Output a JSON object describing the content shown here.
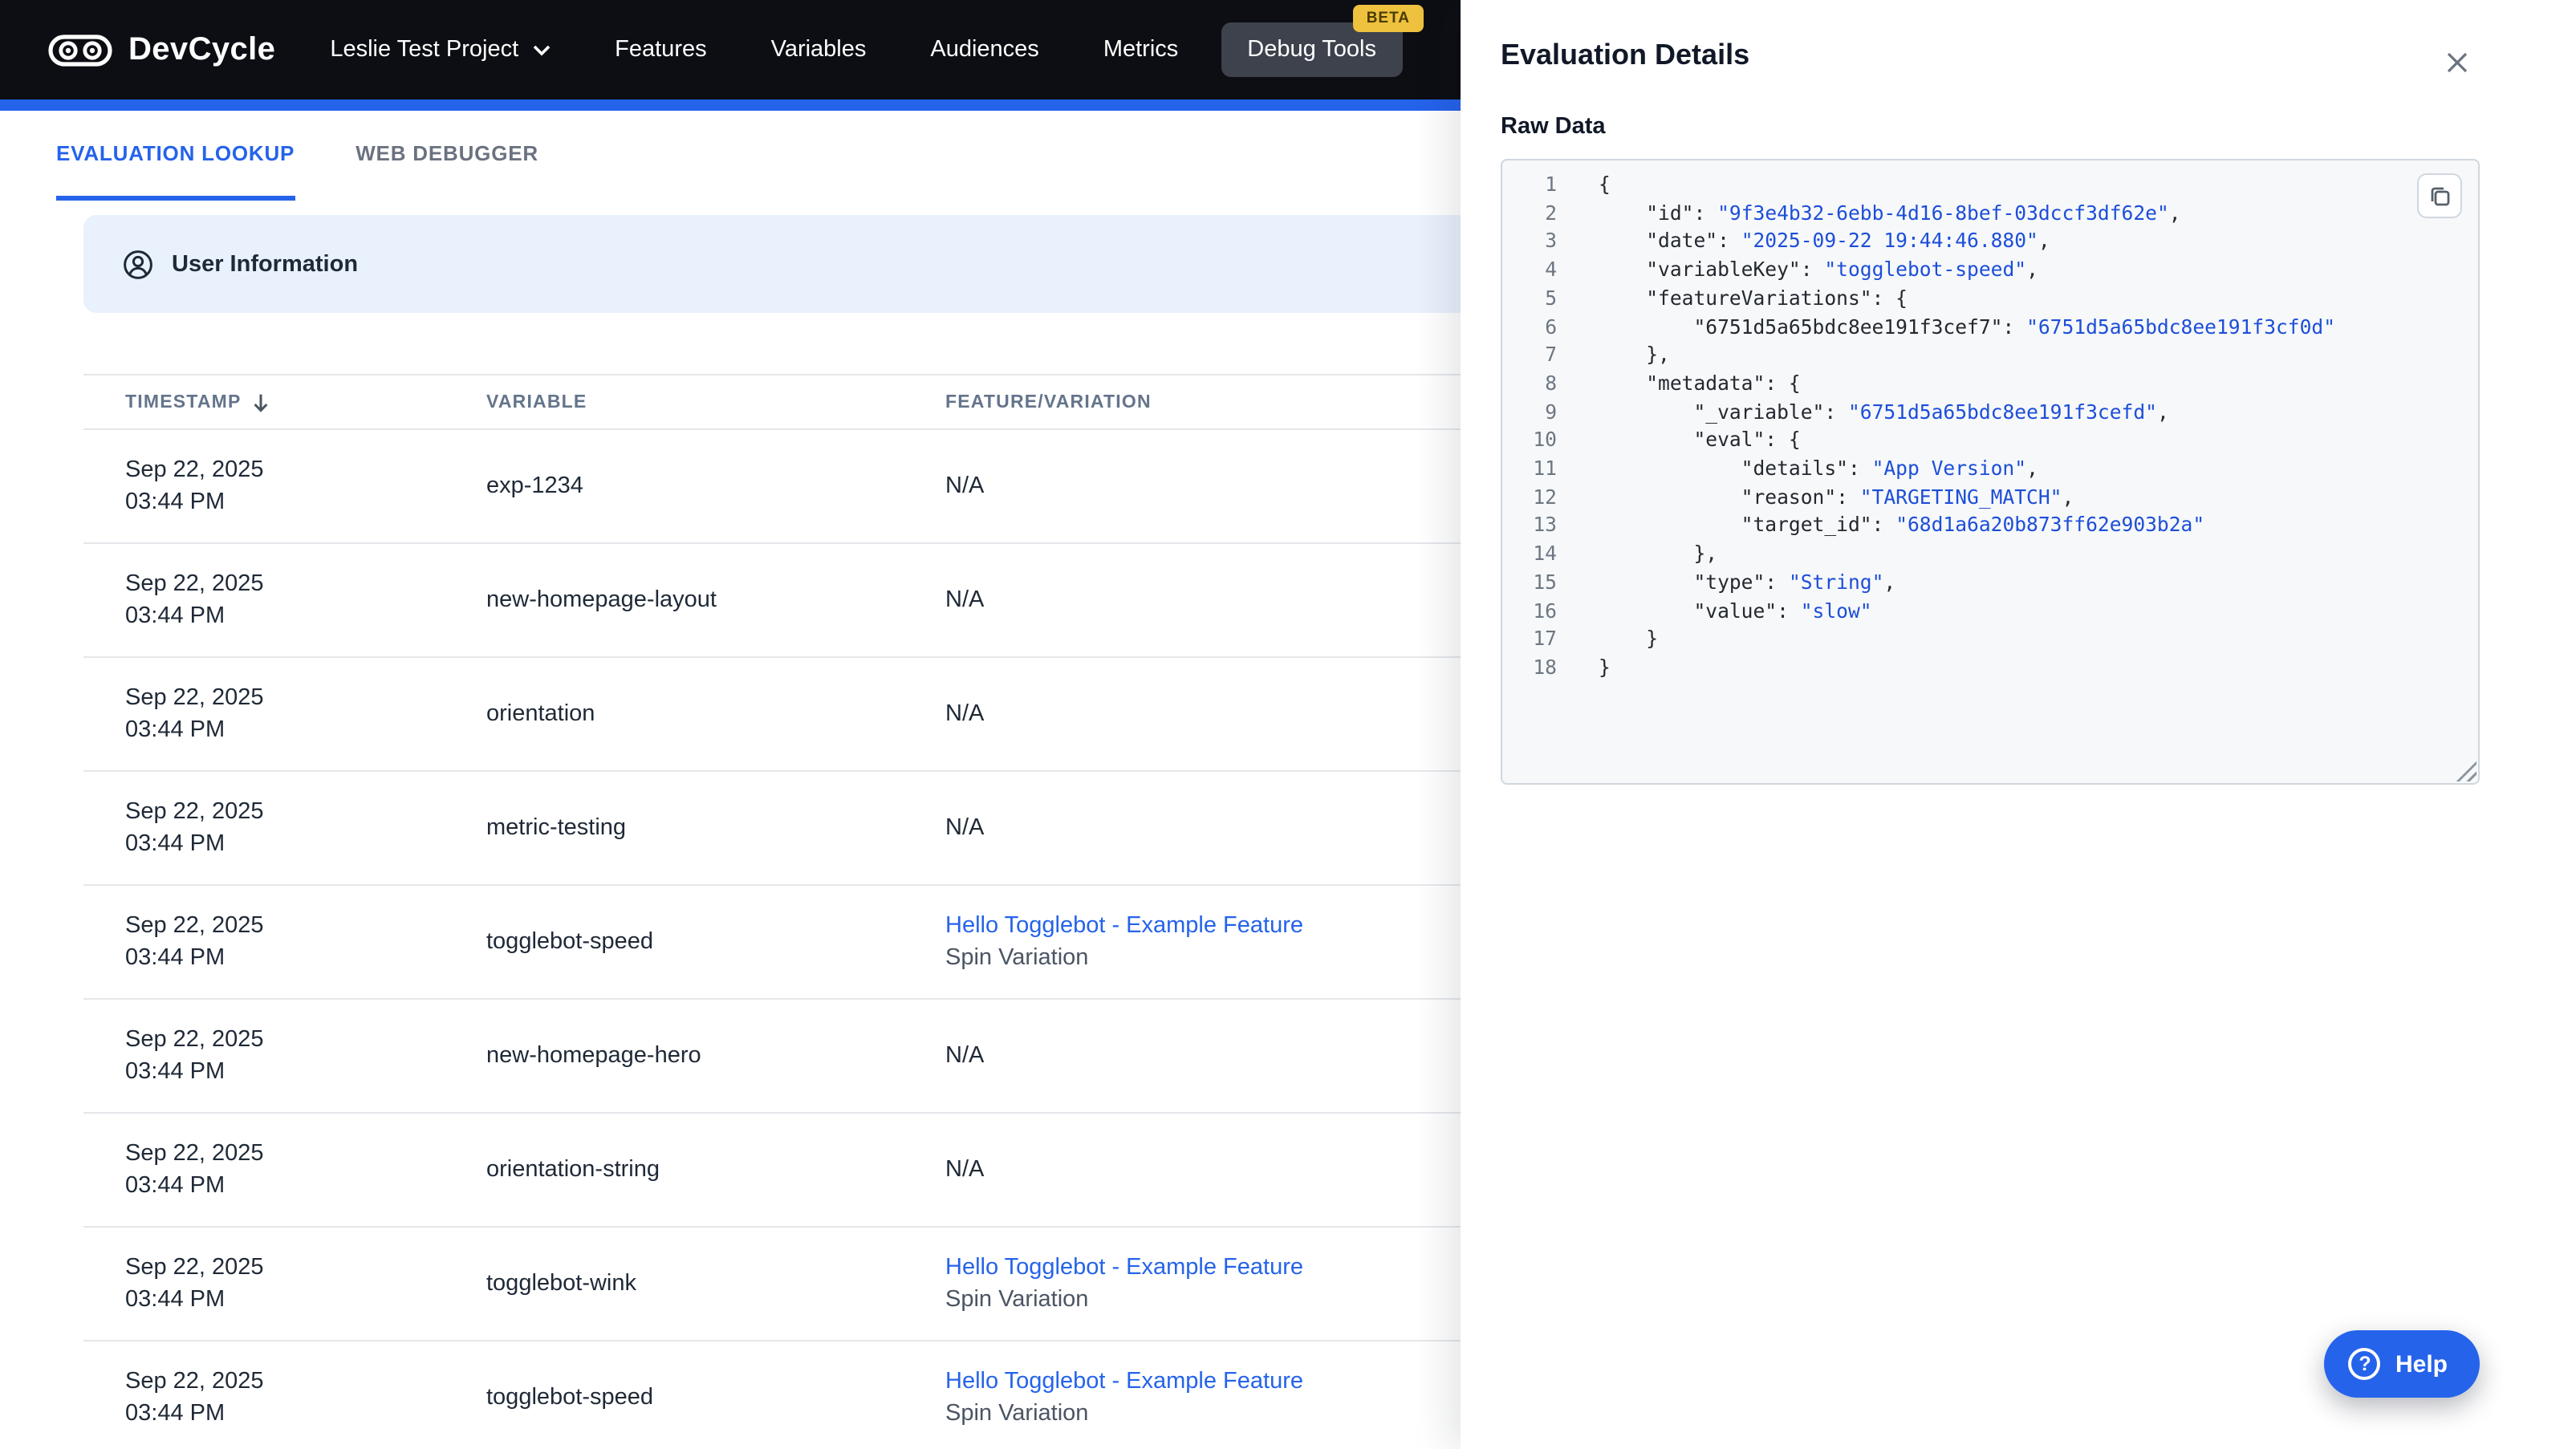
{
  "nav": {
    "brand": "DevCycle",
    "project": "Leslie Test Project",
    "items": [
      {
        "label": "Features"
      },
      {
        "label": "Variables"
      },
      {
        "label": "Audiences"
      },
      {
        "label": "Metrics"
      },
      {
        "label": "Debug Tools",
        "badge": "BETA"
      }
    ]
  },
  "tabs": [
    {
      "label": "EVALUATION LOOKUP"
    },
    {
      "label": "WEB DEBUGGER"
    }
  ],
  "banner": {
    "label": "User Information"
  },
  "table": {
    "columns": [
      "TIMESTAMP",
      "VARIABLE",
      "FEATURE/VARIATION"
    ],
    "rows": [
      {
        "date": "Sep 22, 2025",
        "time": "03:44 PM",
        "variable": "exp-1234",
        "feature": "N/A"
      },
      {
        "date": "Sep 22, 2025",
        "time": "03:44 PM",
        "variable": "new-homepage-layout",
        "feature": "N/A"
      },
      {
        "date": "Sep 22, 2025",
        "time": "03:44 PM",
        "variable": "orientation",
        "feature": "N/A"
      },
      {
        "date": "Sep 22, 2025",
        "time": "03:44 PM",
        "variable": "metric-testing",
        "feature": "N/A"
      },
      {
        "date": "Sep 22, 2025",
        "time": "03:44 PM",
        "variable": "togglebot-speed",
        "feature_link": "Hello Togglebot - Example Feature",
        "variation": "Spin Variation"
      },
      {
        "date": "Sep 22, 2025",
        "time": "03:44 PM",
        "variable": "new-homepage-hero",
        "feature": "N/A"
      },
      {
        "date": "Sep 22, 2025",
        "time": "03:44 PM",
        "variable": "orientation-string",
        "feature": "N/A"
      },
      {
        "date": "Sep 22, 2025",
        "time": "03:44 PM",
        "variable": "togglebot-wink",
        "feature_link": "Hello Togglebot - Example Feature",
        "variation": "Spin Variation"
      },
      {
        "date": "Sep 22, 2025",
        "time": "03:44 PM",
        "variable": "togglebot-speed",
        "feature_link": "Hello Togglebot - Example Feature",
        "variation": "Spin Variation"
      }
    ]
  },
  "panel": {
    "title": "Evaluation Details",
    "section_label": "Raw Data",
    "code": {
      "lines": [
        [
          [
            "{",
            "p"
          ]
        ],
        [
          [
            "    \"id\": ",
            "p"
          ],
          [
            "\"9f3e4b32-6ebb-4d16-8bef-03dccf3df62e\"",
            "v"
          ],
          [
            ",",
            "p"
          ]
        ],
        [
          [
            "    \"date\": ",
            "p"
          ],
          [
            "\"2025-09-22 19:44:46.880\"",
            "v"
          ],
          [
            ",",
            "p"
          ]
        ],
        [
          [
            "    \"variableKey\": ",
            "p"
          ],
          [
            "\"togglebot-speed\"",
            "v"
          ],
          [
            ",",
            "p"
          ]
        ],
        [
          [
            "    \"featureVariations\": {",
            "p"
          ]
        ],
        [
          [
            "        \"6751d5a65bdc8ee191f3cef7\": ",
            "p"
          ],
          [
            "\"6751d5a65bdc8ee191f3cf0d\"",
            "v"
          ]
        ],
        [
          [
            "    },",
            "p"
          ]
        ],
        [
          [
            "    \"metadata\": {",
            "p"
          ]
        ],
        [
          [
            "        \"_variable\": ",
            "p"
          ],
          [
            "\"6751d5a65bdc8ee191f3cefd\"",
            "v"
          ],
          [
            ",",
            "p"
          ]
        ],
        [
          [
            "        \"eval\": {",
            "p"
          ]
        ],
        [
          [
            "            \"details\": ",
            "p"
          ],
          [
            "\"App Version\"",
            "v"
          ],
          [
            ",",
            "p"
          ]
        ],
        [
          [
            "            \"reason\": ",
            "p"
          ],
          [
            "\"TARGETING_MATCH\"",
            "v"
          ],
          [
            ",",
            "p"
          ]
        ],
        [
          [
            "            \"target_id\": ",
            "p"
          ],
          [
            "\"68d1a6a20b873ff62e903b2a\"",
            "v"
          ]
        ],
        [
          [
            "        },",
            "p"
          ]
        ],
        [
          [
            "        \"type\": ",
            "p"
          ],
          [
            "\"String\"",
            "v"
          ],
          [
            ",",
            "p"
          ]
        ],
        [
          [
            "        \"value\": ",
            "p"
          ],
          [
            "\"slow\"",
            "v"
          ]
        ],
        [
          [
            "    }",
            "p"
          ]
        ],
        [
          [
            "}",
            "p"
          ]
        ]
      ]
    }
  },
  "help": {
    "label": "Help",
    "icon_glyph": "?"
  },
  "colors": {
    "accent": "#2563eb",
    "nav_bg": "#0c0e13",
    "beta_badge": "#eec23e",
    "banner_bg": "#e9f1fd",
    "link": "#2563eb",
    "code_string": "#1d4ed8"
  }
}
